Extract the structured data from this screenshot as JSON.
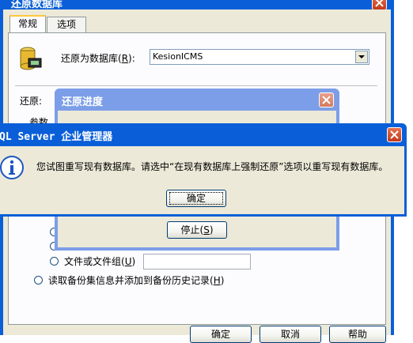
{
  "restore_dialog": {
    "title": "还原数据库",
    "tabs": [
      "常规",
      "选项"
    ],
    "db_label_prefix": "还原为数据库(",
    "db_label_key": "R",
    "db_label_suffix": "):",
    "db_value": "KesionICMS",
    "restore_label": "还原:",
    "params_label": "参数",
    "option_filegroup": {
      "prefix": "文件或文件组(",
      "key": "U",
      "suffix": ")"
    },
    "option_read_backup": {
      "prefix": "读取备份集信息并添加到备份历史记录(",
      "key": "H",
      "suffix": ")"
    },
    "buttons": {
      "ok": "确定",
      "cancel": "取消",
      "help": "帮助"
    }
  },
  "progress_dialog": {
    "title": "还原进度",
    "stop": {
      "prefix": "停止(",
      "key": "S",
      "suffix": ")"
    }
  },
  "message_box": {
    "title": "QL Server 企业管理器",
    "message": "您试图重写现有数据库。请选中“在现有数据库上强制还原”选项以重写现有数据库。",
    "ok_label": "确定",
    "icon": "info-icon"
  },
  "colors": {
    "xp_title": "#0a5fd8",
    "xp_face": "#ece9d8",
    "inactive_title": "#7c9ee8",
    "close_red": "#d44a25"
  }
}
